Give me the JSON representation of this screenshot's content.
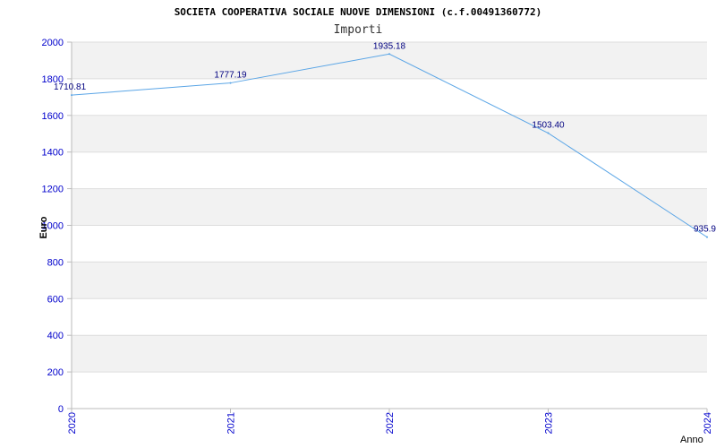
{
  "chart_data": {
    "type": "line",
    "title": "SOCIETA COOPERATIVA SOCIALE NUOVE DIMENSIONI (c.f.00491360772)",
    "subtitle": "Importi",
    "xlabel": "Anno",
    "ylabel": "Euro",
    "categories": [
      "2020",
      "2021",
      "2022",
      "2023",
      "2024"
    ],
    "values": [
      1710.81,
      1777.19,
      1935.18,
      1503.4,
      935.9
    ],
    "value_labels": [
      "1710.81",
      "1777.19",
      "1935.18",
      "1503.40",
      "935.9"
    ],
    "ylim": [
      0,
      2000
    ],
    "yticks": [
      0,
      200,
      400,
      600,
      800,
      1000,
      1200,
      1400,
      1600,
      1800,
      2000
    ],
    "grid": true,
    "colors": {
      "line": "#5aa5e6",
      "band": "#f2f2f2",
      "tick_text": "#0000cc",
      "data_label": "#000080",
      "axis": "#bbbbbb",
      "title": "#000000"
    }
  }
}
